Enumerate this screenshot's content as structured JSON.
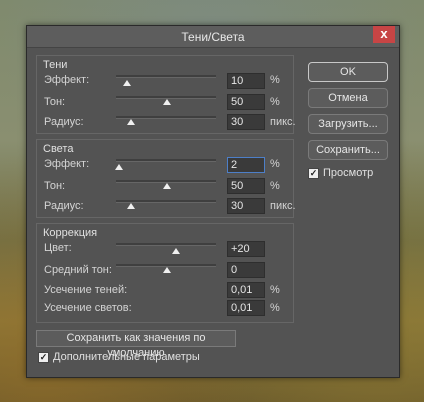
{
  "title": "Тени/Света",
  "close_symbol": "x",
  "shadows": {
    "title": "Тени",
    "amount_label": "Эффект:",
    "amount_value": "10",
    "amount_unit": "%",
    "tone_label": "Тон:",
    "tone_value": "50",
    "tone_unit": "%",
    "radius_label": "Радиус:",
    "radius_value": "30",
    "radius_unit": "пикс."
  },
  "highlights": {
    "title": "Света",
    "amount_label": "Эффект:",
    "amount_value": "2",
    "amount_unit": "%",
    "tone_label": "Тон:",
    "tone_value": "50",
    "tone_unit": "%",
    "radius_label": "Радиус:",
    "radius_value": "30",
    "radius_unit": "пикс."
  },
  "correction": {
    "title": "Коррекция",
    "color_label": "Цвет:",
    "color_value": "+20",
    "midtone_label": "Средний тон:",
    "midtone_value": "0",
    "clip_shadows_label": "Усечение теней:",
    "clip_shadows_value": "0,01",
    "clip_shadows_unit": "%",
    "clip_highlights_label": "Усечение светов:",
    "clip_highlights_value": "0,01",
    "clip_highlights_unit": "%"
  },
  "buttons": {
    "ok": "OK",
    "cancel": "Отмена",
    "load": "Загрузить...",
    "save": "Сохранить...",
    "preview": "Просмотр",
    "save_defaults": "Сохранить как значения по умолчанию",
    "more_options": "Дополнительные параметры"
  },
  "checkbox_state": {
    "preview_checked": true,
    "more_options_checked": true
  }
}
